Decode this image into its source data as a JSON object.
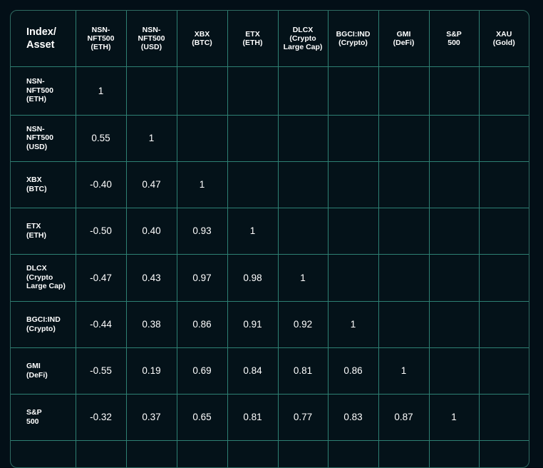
{
  "chart_data": {
    "type": "table",
    "corner_label": "Index/\nAsset",
    "columns": [
      "NSN-\nNFT500\n(ETH)",
      "NSN-\nNFT500\n(USD)",
      "XBX\n(BTC)",
      "ETX\n(ETH)",
      "DLCX\n(Crypto\nLarge Cap)",
      "BGCI:IND\n(Crypto)",
      "GMI\n(DeFi)",
      "S&P\n500",
      "XAU\n(Gold)"
    ],
    "rows": [
      {
        "label": "NSN-\nNFT500\n(ETH)",
        "values": [
          "1",
          "",
          "",
          "",
          "",
          "",
          "",
          "",
          ""
        ]
      },
      {
        "label": "NSN-\nNFT500\n(USD)",
        "values": [
          "0.55",
          "1",
          "",
          "",
          "",
          "",
          "",
          "",
          ""
        ]
      },
      {
        "label": "XBX\n(BTC)",
        "values": [
          "-0.40",
          "0.47",
          "1",
          "",
          "",
          "",
          "",
          "",
          ""
        ]
      },
      {
        "label": "ETX\n(ETH)",
        "values": [
          "-0.50",
          "0.40",
          "0.93",
          "1",
          "",
          "",
          "",
          "",
          ""
        ]
      },
      {
        "label": "DLCX\n(Crypto\nLarge Cap)",
        "values": [
          "-0.47",
          "0.43",
          "0.97",
          "0.98",
          "1",
          "",
          "",
          "",
          ""
        ]
      },
      {
        "label": "BGCI:IND\n(Crypto)",
        "values": [
          "-0.44",
          "0.38",
          "0.86",
          "0.91",
          "0.92",
          "1",
          "",
          "",
          ""
        ]
      },
      {
        "label": "GMI\n(DeFi)",
        "values": [
          "-0.55",
          "0.19",
          "0.69",
          "0.84",
          "0.81",
          "0.86",
          "1",
          "",
          ""
        ]
      },
      {
        "label": "S&P\n500",
        "values": [
          "-0.32",
          "0.37",
          "0.65",
          "0.81",
          "0.77",
          "0.83",
          "0.87",
          "1",
          ""
        ]
      },
      {
        "label": "",
        "values": [
          "",
          "",
          "",
          "",
          "",
          "",
          "",
          "",
          ""
        ]
      }
    ]
  }
}
